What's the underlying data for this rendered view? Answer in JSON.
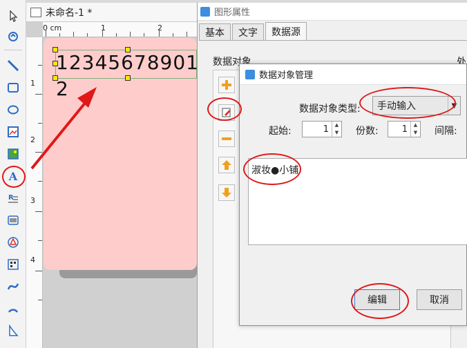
{
  "document": {
    "title": "未命名-1 *"
  },
  "rulers": {
    "top_numbers": [
      "0 cm",
      "1",
      "2"
    ],
    "left_numbers": [
      "1",
      "2",
      "3",
      "4"
    ]
  },
  "label": {
    "text_line1": "12345678901",
    "text_line2": "2"
  },
  "props_window": {
    "title": "图形属性",
    "tabs": [
      {
        "label": "基本"
      },
      {
        "label": "文字"
      },
      {
        "label": "数据源",
        "active": true
      }
    ],
    "data_object_label": "数据对象",
    "processing_label": "处"
  },
  "dialog": {
    "title": "数据对象管理",
    "type_label": "数据对象类型:",
    "type_value": "手动输入",
    "start_label": "起始:",
    "start_value": "1",
    "copies_label": "份数:",
    "copies_value": "1",
    "interval_label": "间隔:",
    "text_value": "淑妆●小铺",
    "edit_label": "编辑",
    "cancel_label": "取消"
  },
  "colors": {
    "label_bg": "#ffcccc",
    "annotation_red": "#e01818",
    "accent_blue": "#2b6cc4"
  },
  "icons": [
    "pointer-icon",
    "pan-icon",
    "line-icon",
    "rectangle-icon",
    "ellipse-icon",
    "image-icon",
    "picture-icon",
    "text-icon",
    "rich-text-icon",
    "barcode-icon",
    "qrcode-icon",
    "pdf417-icon",
    "curve-icon",
    "arc-icon",
    "polygon-icon"
  ]
}
